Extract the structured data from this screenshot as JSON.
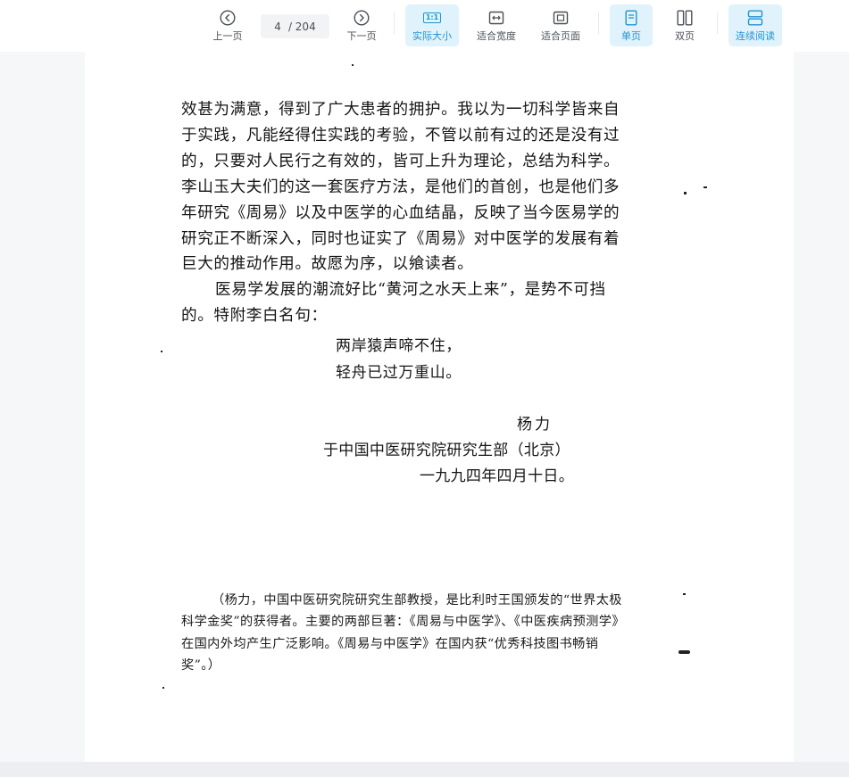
{
  "toolbar": {
    "prev_label": "上一页",
    "next_label": "下一页",
    "current_page": "4",
    "total_pages": "/ 204",
    "actual_size_label": "实际大小",
    "actual_size_icon_text": "1:1",
    "fit_width_label": "适合宽度",
    "fit_page_label": "适合页面",
    "single_page_label": "单页",
    "double_page_label": "双页",
    "continuous_label": "连续阅读",
    "accent_color": "#1f95d1",
    "active_bg": "#e0f2fb"
  },
  "document": {
    "paragraph1": "效甚为满意，得到了广大患者的拥护。我以为一切科学皆来自于实践，凡能经得住实践的考验，不管以前有过的还是没有过的，只要对人民行之有效的，皆可上升为理论，总结为科学。李山玉大夫们的这一套医疗方法，是他们的首创，也是他们多年研究《周易》以及中医学的心血结晶，反映了当今医易学的研究正不断深入，同时也证实了《周易》对中医学的发展有着巨大的推动作用。故愿为序，以飨读者。",
    "paragraph2": "医易学发展的潮流好比“黄河之水天上来”，是势不可挡的。特附李白名句：",
    "poem_line1": "两岸猿声啼不住，",
    "poem_line2": "轻舟已过万重山。",
    "signature_name": "杨力",
    "signature_place": "于中国中医研究院研究生部（北京）",
    "signature_date": "一九九四年四月十日。",
    "note": "（杨力，中国中医研究院研究生部教授，是比利时王国颁发的“世界太极科学金奖”的获得者。主要的两部巨著：《周易与中医学》、《中医疾病预测学》在国内外均产生广泛影响。《周易与中医学》在国内获“优秀科技图书畅销奖”。）"
  }
}
